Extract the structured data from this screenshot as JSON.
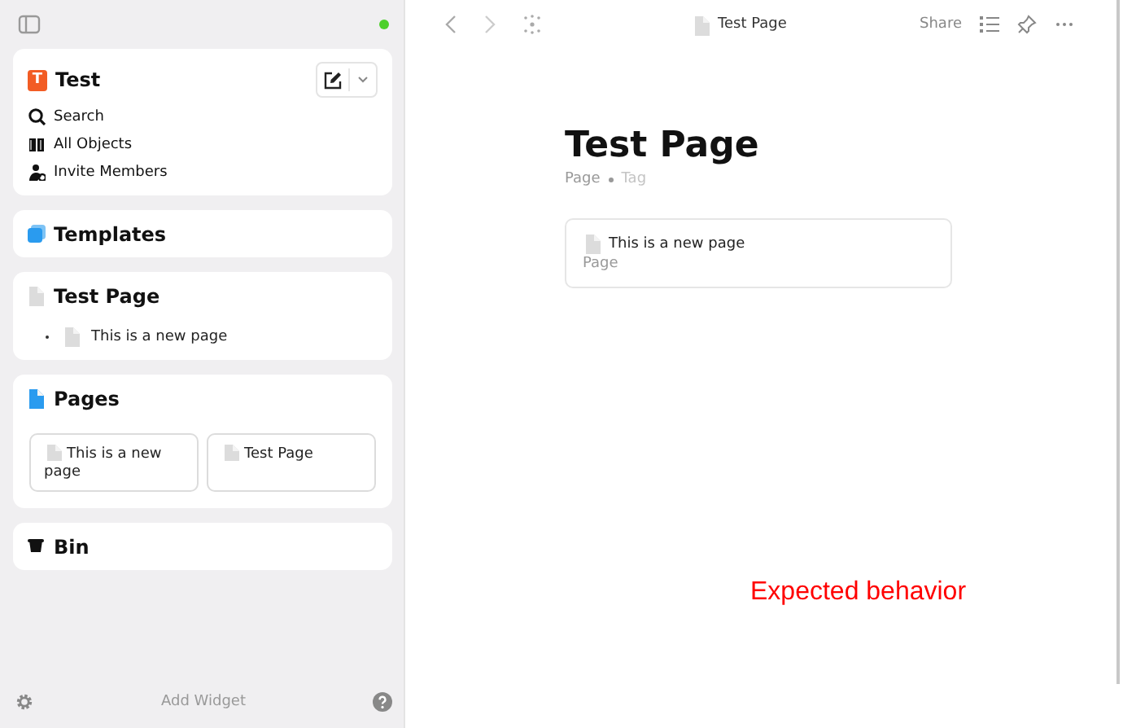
{
  "sidebar": {
    "online": true,
    "space": {
      "badge": "T",
      "name": "Test",
      "links": [
        {
          "kind": "search",
          "label": "Search"
        },
        {
          "kind": "objects",
          "label": "All Objects"
        },
        {
          "kind": "invite",
          "label": "Invite Members"
        }
      ]
    },
    "widgets": [
      {
        "kind": "templates",
        "title": "Templates"
      },
      {
        "kind": "tree",
        "title": "Test Page",
        "items": [
          "This is a new page"
        ]
      },
      {
        "kind": "gallery",
        "title": "Pages",
        "cards": [
          "This is a new page",
          "Test Page"
        ]
      },
      {
        "kind": "bin",
        "title": "Bin"
      }
    ],
    "add_widget": "Add Widget"
  },
  "toolbar": {
    "title": "Test Page",
    "share": "Share"
  },
  "page": {
    "title": "Test Page",
    "type": "Page",
    "tag": "Tag",
    "links": [
      {
        "title": "This is a new page",
        "type": "Page"
      }
    ]
  },
  "annotation": "Expected behavior"
}
